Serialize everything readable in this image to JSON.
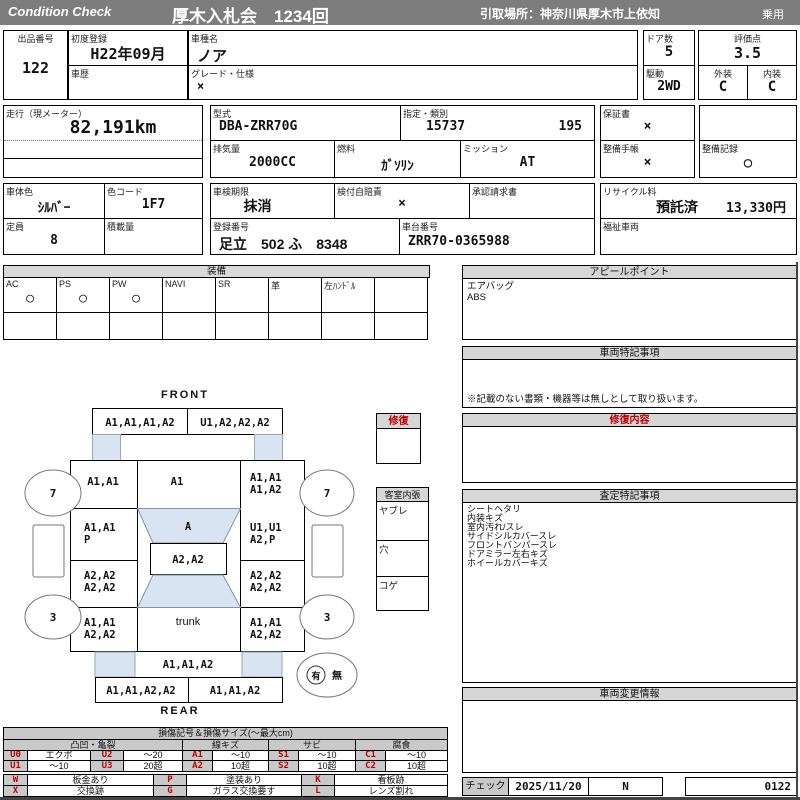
{
  "header": {
    "brand": "Condition  Check",
    "title": "厚木入札会　1234回",
    "pickup": "引取場所：神奈川県厚木市上依知",
    "vehicle_type": "乗用"
  },
  "info": {
    "lot_label": "出品番号",
    "lot_no": "122",
    "first_reg_label": "初度登録",
    "first_reg": "H22年09月",
    "history_label": "車歴",
    "history": "",
    "model_label": "車種名",
    "model": "ノア",
    "grade_label": "グレード・仕様",
    "grade": "×",
    "doors_label": "ドア数",
    "doors": "5",
    "score_label": "評価点",
    "score": "3.5",
    "drive_label": "駆動",
    "drive": "2WD",
    "exterior_label": "外装",
    "exterior": "C",
    "interior_label": "内装",
    "interior": "C",
    "mileage_label": "走行（現メーター）",
    "mileage": "82,191km",
    "model_code_label": "型式",
    "model_code": "DBA-ZRR70G",
    "class_label": "指定・類別",
    "class_no": "15737",
    "class_no2": "195",
    "displacement_label": "排気量",
    "displacement": "2000CC",
    "fuel_label": "燃料",
    "fuel": "ｶﾞｿﾘﾝ",
    "transmission_label": "ミッション",
    "transmission": "AT",
    "warranty_label": "保証書",
    "warranty": "×",
    "maintenance_book_label": "整備手帳",
    "maintenance_book": "×",
    "maintenance_record_label": "整備記録",
    "maintenance_record": "○",
    "body_color_label": "車体色",
    "body_color": "ｼﾙﾊﾞｰ",
    "color_code_label": "色コード",
    "color_code": "1F7",
    "inspection_label": "車検期限",
    "inspection": "抹消",
    "insurance_label": "検付自賠責",
    "insurance": "×",
    "approval_label": "承認請求書",
    "approval": "",
    "recycle_label": "リサイクル料",
    "recycle_status": "預託済",
    "recycle_fee": "13,330円",
    "capacity_label": "定員",
    "capacity": "8",
    "load_label": "積載量",
    "load": "",
    "reg_no_label": "登録番号",
    "reg_no": "足立　502 ふ　8348",
    "chassis_label": "車台番号",
    "chassis_no": "ZRR70-0365988",
    "welfare_label": "福祉車両",
    "welfare": ""
  },
  "equipment": {
    "title": "装備",
    "items": [
      {
        "label": "AC",
        "value": "○"
      },
      {
        "label": "PS",
        "value": "○"
      },
      {
        "label": "PW",
        "value": "○"
      },
      {
        "label": "NAVI",
        "value": ""
      },
      {
        "label": "SR",
        "value": ""
      },
      {
        "label": "革",
        "value": ""
      },
      {
        "label": "左ﾊﾝﾄﾞﾙ",
        "value": ""
      },
      {
        "label": "",
        "value": ""
      }
    ]
  },
  "sections": {
    "appeal": {
      "title": "アピールポイント",
      "lines": [
        "エアバッグ",
        "ABS"
      ]
    },
    "notes": {
      "title": "車両特記事項",
      "footer": "※記載のない書類・機器等は無しとして取り扱います。"
    },
    "repair_detail": {
      "title": "修復内容"
    },
    "assessment": {
      "title": "査定特記事項",
      "lines": [
        "シートヘタリ",
        "内装キズ",
        "室内汚れ/スレ",
        "サイドシルカバースレ",
        "フロントバンパースレ",
        "ドアミラー左右キズ",
        "ホイールカバーキズ"
      ]
    },
    "change_info": {
      "title": "車両変更情報"
    },
    "check": {
      "label": "チェック",
      "date": "2025/11/20",
      "flag": "N",
      "number": "0122"
    }
  },
  "interior_panel": {
    "repair_title": "修復",
    "lining_title": "客室内張",
    "rows": [
      "ヤブレ",
      "穴",
      "コゲ"
    ]
  },
  "diagram": {
    "front_label": "FRONT",
    "rear_label": "REAR",
    "trunk": "trunk",
    "front_bumper": [
      "A1,A1,A1,A2",
      "U1,A2,A2,A2"
    ],
    "hood": "A1",
    "windshield": "A",
    "roof": "A2,A2",
    "rear_gate": "A1,A1,A2",
    "rear_bumper": [
      "A1,A1,A2,A2",
      "A1,A1,A2"
    ],
    "left": {
      "fender_f": "A1,A1",
      "door_f": [
        "A1,A1",
        "P"
      ],
      "door_r": [
        "A2,A2",
        "A2,A2"
      ],
      "fender_r": [
        "A1,A1",
        "A2,A2"
      ]
    },
    "right": {
      "fender_f": [
        "A1,A1",
        "A1,A2"
      ],
      "door_f": [
        "U1,U1",
        "A2,P"
      ],
      "door_r": [
        "A2,A2",
        "A2,A2"
      ],
      "fender_r": [
        "A1,A1",
        "A2,A2"
      ]
    },
    "tires": {
      "front_left": "7",
      "front_right": "7",
      "rear_left": "3",
      "rear_right": "3"
    },
    "spare": {
      "yes": "有",
      "no": "無"
    }
  },
  "legend": {
    "title": "損傷記号＆損傷サイズ(〜最大cm)",
    "groups": [
      "凸凹・亀裂",
      "線キズ",
      "サビ",
      "腐食"
    ],
    "row1": [
      {
        "k": "U0",
        "v": "エクボ"
      },
      {
        "k": "U2",
        "v": "〜20"
      },
      {
        "k": "A1",
        "v": "〜10"
      },
      {
        "k": "S1",
        "v": "〜10"
      },
      {
        "k": "C1",
        "v": "〜10"
      }
    ],
    "row2": [
      {
        "k": "U1",
        "v": "〜10"
      },
      {
        "k": "U3",
        "v": "20超"
      },
      {
        "k": "A2",
        "v": "10超"
      },
      {
        "k": "S2",
        "v": "10超"
      },
      {
        "k": "C2",
        "v": "10超"
      }
    ],
    "row3": [
      {
        "k": "W",
        "v": "板金あり"
      },
      {
        "k": "P",
        "v": "塗装あり"
      },
      {
        "k": "K",
        "v": "看板跡"
      }
    ],
    "row4": [
      {
        "k": "X",
        "v": "交換跡"
      },
      {
        "k": "G",
        "v": "ガラス交換要す"
      },
      {
        "k": "L",
        "v": "レンズ割れ"
      }
    ]
  },
  "colors": {
    "accent_red": "#c00000",
    "accent_blue": "#2222cc",
    "glass_blue": "#d9e4f2",
    "bar_gray": "#7d7d7d"
  }
}
